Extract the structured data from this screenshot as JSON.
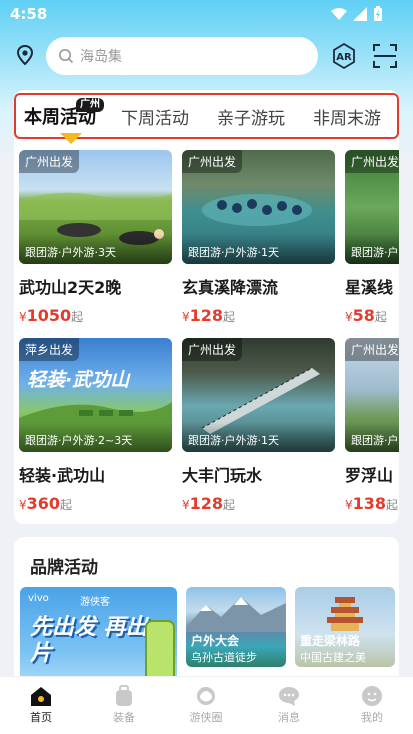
{
  "status": {
    "time": "4:58"
  },
  "search": {
    "placeholder": "海岛集"
  },
  "tabs": [
    {
      "label": "本周活动",
      "badge": "广州"
    },
    {
      "label": "下周活动"
    },
    {
      "label": "亲子游玩"
    },
    {
      "label": "非周末游"
    }
  ],
  "activities": [
    {
      "origin": "广州出发",
      "category": "跟团游·户外游·3天",
      "name": "武功山2天2晚",
      "currency": "¥",
      "price": "1050",
      "suffix": "起"
    },
    {
      "origin": "广州出发",
      "category": "跟团游·户外游·1天",
      "name": "玄真溪降漂流",
      "currency": "¥",
      "price": "128",
      "suffix": "起"
    },
    {
      "origin": "广州出发",
      "category": "跟团游·户",
      "name": "星溪线",
      "currency": "¥",
      "price": "58",
      "suffix": "起"
    },
    {
      "origin": "萍乡出发",
      "category": "跟团游·户外游·2~3天",
      "name": "轻装·武功山",
      "currency": "¥",
      "price": "360",
      "suffix": "起",
      "overlay_text": "轻装·武功山"
    },
    {
      "origin": "广州出发",
      "category": "跟团游·户外游·1天",
      "name": "大丰门玩水",
      "currency": "¥",
      "price": "128",
      "suffix": "起"
    },
    {
      "origin": "广州出发",
      "category": "跟团游·户",
      "name": "罗浮山",
      "currency": "¥",
      "price": "138",
      "suffix": "起"
    }
  ],
  "brand": {
    "title": "品牌活动",
    "cards": [
      {
        "logo": "vivo",
        "partner": "游侠客",
        "art_text": "先出发 再出片"
      },
      {
        "title": "户外大会",
        "subtitle": "乌孙古道徒步"
      },
      {
        "title": "重走梁林路",
        "subtitle": "中国古建之美"
      }
    ]
  },
  "nav": [
    {
      "label": "首页",
      "icon": "home-icon"
    },
    {
      "label": "装备",
      "icon": "backpack-icon"
    },
    {
      "label": "游侠圈",
      "icon": "circle-community-icon"
    },
    {
      "label": "消息",
      "icon": "message-icon"
    },
    {
      "label": "我的",
      "icon": "profile-icon"
    }
  ],
  "colors": {
    "accent_red": "#e23b2e",
    "price_red": "#e83a2c",
    "indicator": "#f6b81a",
    "sky": "#5fd0f5"
  }
}
